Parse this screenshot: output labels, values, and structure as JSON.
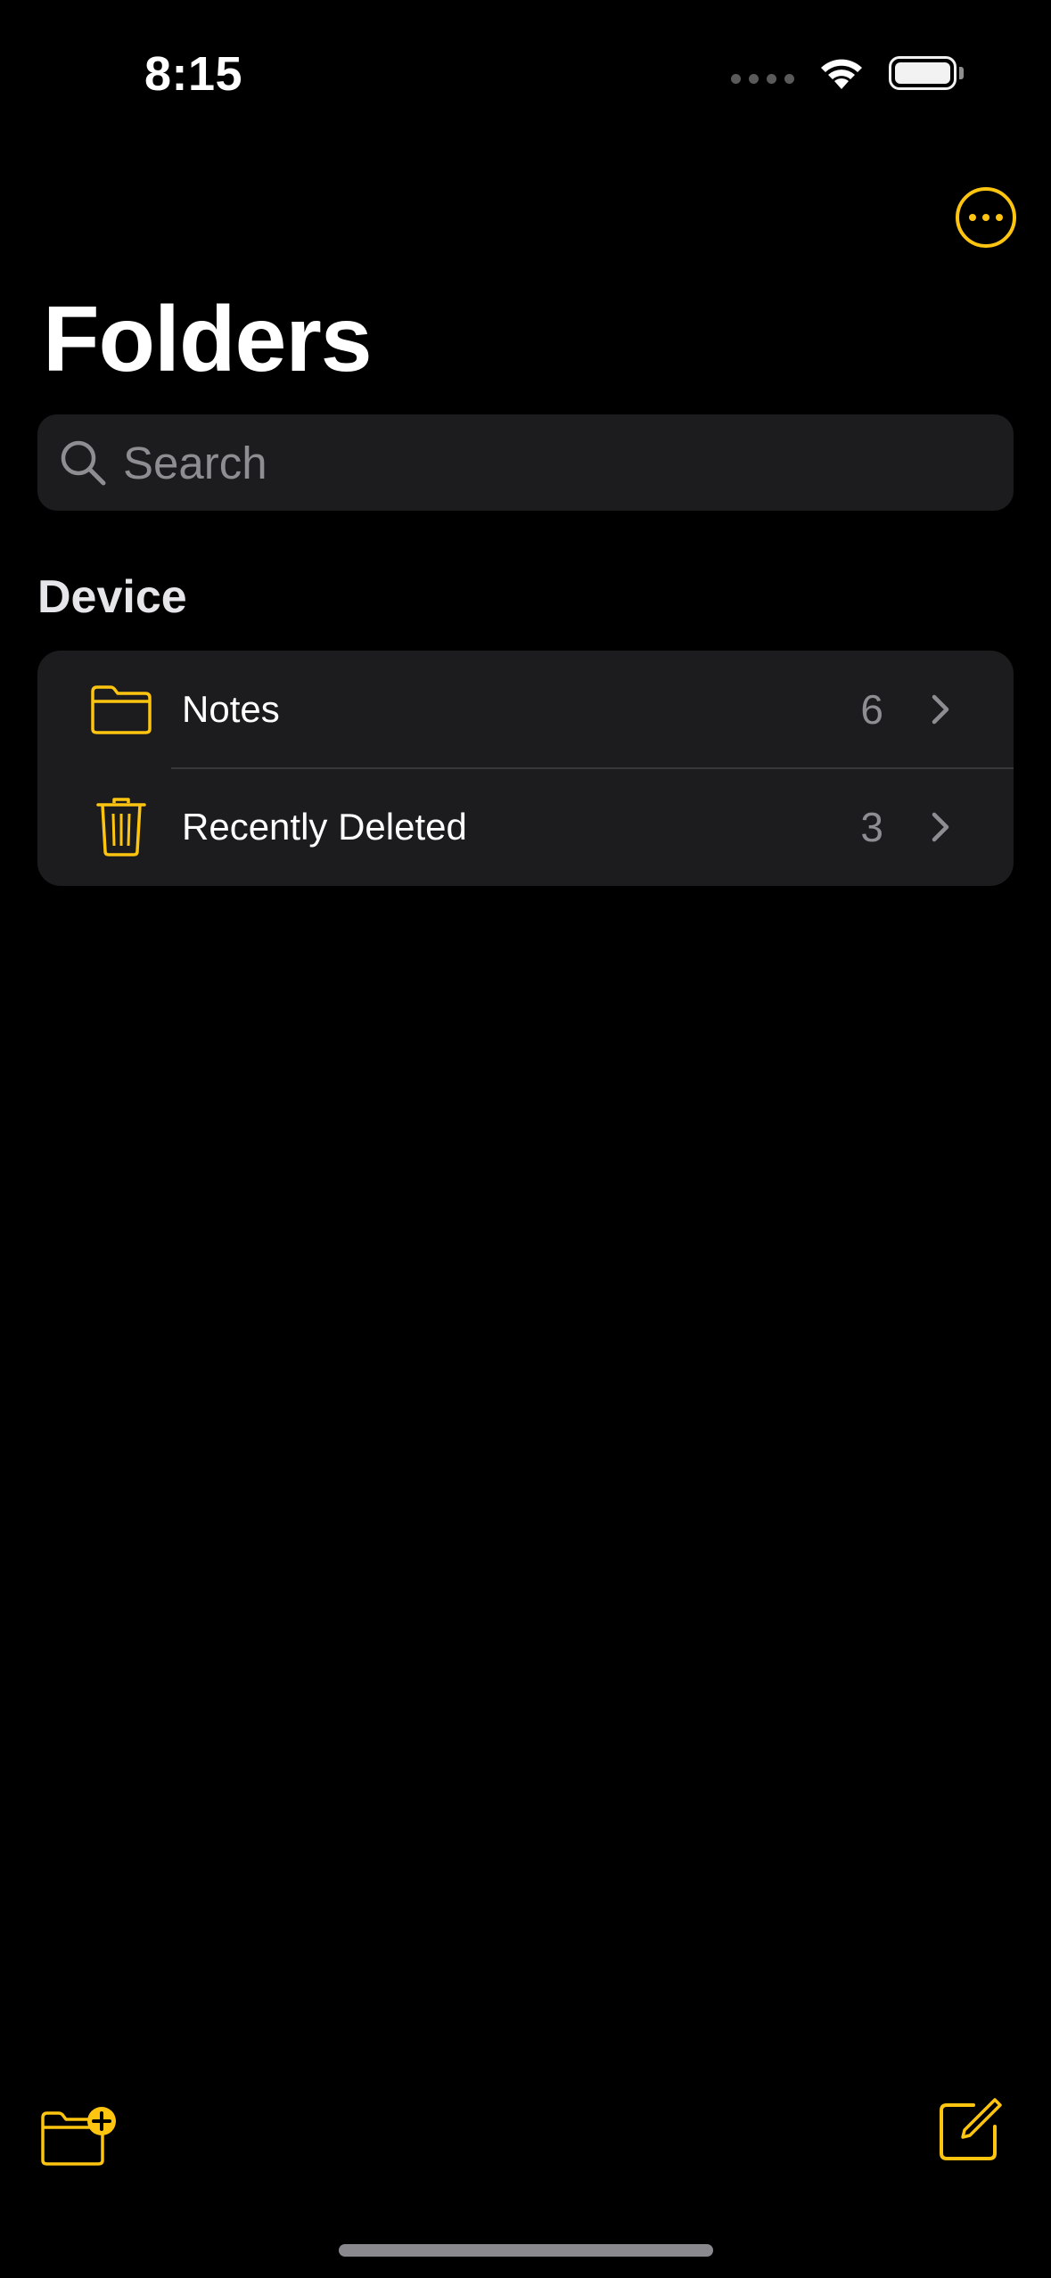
{
  "status_bar": {
    "time": "8:15"
  },
  "header": {
    "title": "Folders"
  },
  "search": {
    "placeholder": "Search"
  },
  "sections": [
    {
      "header": "Device",
      "folders": [
        {
          "label": "Notes",
          "count": "6",
          "icon": "folder-icon"
        },
        {
          "label": "Recently Deleted",
          "count": "3",
          "icon": "trash-icon"
        }
      ]
    }
  ],
  "toolbar": {
    "left_icon": "new-folder-icon",
    "right_icon": "compose-icon"
  },
  "colors": {
    "accent": "#fdc410",
    "background": "#000000",
    "cell": "#1c1c1e",
    "secondary_text": "#8d8d92"
  }
}
